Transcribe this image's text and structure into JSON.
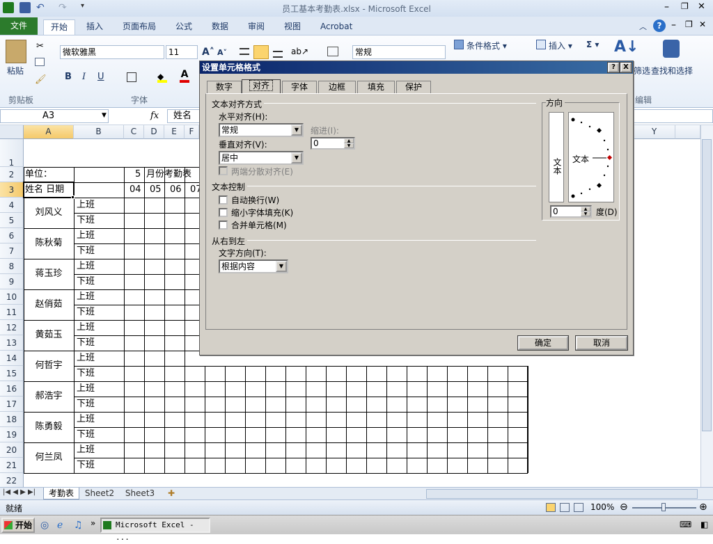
{
  "window": {
    "title": "员工基本考勤表.xlsx - Microsoft Excel"
  },
  "ribbon": {
    "tabs": [
      "文件",
      "开始",
      "插入",
      "页面布局",
      "公式",
      "数据",
      "审阅",
      "视图",
      "Acrobat"
    ],
    "active_tab": "开始",
    "clipboard": {
      "paste": "粘贴",
      "group": "剪贴板"
    },
    "font": {
      "name": "微软雅黑",
      "size": "11",
      "group": "字体",
      "bold": "B",
      "italic": "I",
      "underline": "U"
    },
    "number": {
      "format": "常规"
    },
    "styles": {
      "conditional": "条件格式 ▾"
    },
    "cells": {
      "insert": "插入 ▾"
    },
    "editing": {
      "sigma": "Σ ▾",
      "find_select": "查找和选择",
      "filter_tail": "筛选",
      "group_tail": "编辑"
    }
  },
  "formula_bar": {
    "name_box": "A3",
    "fx": "fx",
    "content": "姓名"
  },
  "sheet": {
    "columns": [
      "A",
      "B",
      "C",
      "D",
      "E",
      "F",
      "Y"
    ],
    "rows": [
      "1",
      "2",
      "3",
      "4",
      "5",
      "6",
      "7",
      "8",
      "9",
      "10",
      "11",
      "12",
      "13",
      "14",
      "15",
      "16",
      "17",
      "18",
      "19",
      "20",
      "21",
      "22"
    ],
    "unit_label": "单位：",
    "month_num": "5",
    "title_partial": "月份考勤表",
    "header_name": "姓名  日期",
    "dates": [
      "04",
      "05",
      "06",
      "07"
    ],
    "employees": [
      "刘风义",
      "陈秋菊",
      "蒋玉珍",
      "赵俏茹",
      "黄茹玉",
      "何哲宇",
      "郝浩宇",
      "陈勇毅",
      "何兰凤"
    ],
    "shift_on": "上班",
    "shift_off": "下班"
  },
  "sheet_tabs": [
    "考勤表",
    "Sheet2",
    "Sheet3"
  ],
  "status": {
    "ready": "就绪",
    "zoom": "100%"
  },
  "taskbar": {
    "start": "开始",
    "app": "Microsoft Excel - ..."
  },
  "dialog": {
    "title": "设置单元格格式",
    "help": "?",
    "close": "X",
    "tabs": [
      "数字",
      "对齐",
      "字体",
      "边框",
      "填充",
      "保护"
    ],
    "active_tab": "对齐",
    "text_align_group": "文本对齐方式",
    "horizontal_label": "水平对齐(H):",
    "horizontal_value": "常规",
    "indent_label": "缩进(I):",
    "indent_value": "0",
    "vertical_label": "垂直对齐(V):",
    "vertical_value": "居中",
    "justify_distributed": "两端分散对齐(E)",
    "text_control_group": "文本控制",
    "wrap_text": "自动换行(W)",
    "shrink_fit": "缩小字体填充(K)",
    "merge_cells": "合并单元格(M)",
    "rtl_group": "从右到左",
    "text_direction_label": "文字方向(T):",
    "text_direction_value": "根据内容",
    "orientation_group": "方向",
    "orientation_vertical": "文本",
    "orientation_horizontal": "文本",
    "degree_value": "0",
    "degree_label": "度(D)",
    "ok": "确定",
    "cancel": "取消"
  }
}
